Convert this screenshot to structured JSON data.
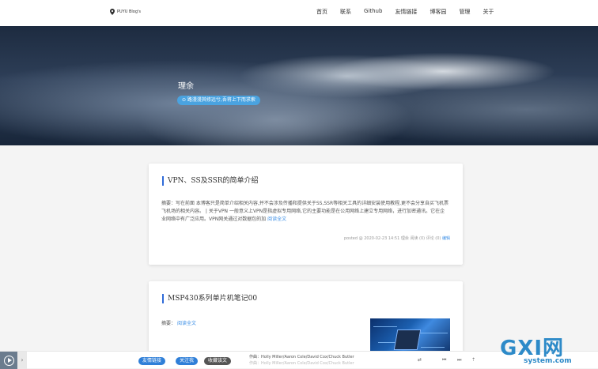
{
  "header": {
    "logo_text": "PUYU Blog's",
    "nav": [
      "首页",
      "联系",
      "Github",
      "友情链接",
      "博客园",
      "管理",
      "关于"
    ]
  },
  "hero": {
    "title": "理余",
    "motto": "⊙ 路漫漫其修远兮,吾将上下而求索"
  },
  "posts": [
    {
      "title": "VPN、SS及SSR的简单介绍",
      "summary": "摘要：写在前面 本博客只是简单介绍相关内容,并不会涉及传播和提供关于SS,SSR等相关工具的详细安装使用教程,更不会分享自买飞机票飞机场的相关内容。 | 关于VPN 一般意义上VPN是指虚拟专用网络,它的主要功能是在公用网络上建立专用网络，进行加密通讯。它在企业网络中有广泛应用。VPN网关通过对数据包的加",
      "read_more": "阅读全文",
      "meta": "posted @ 2020-02-23 14:51 理余 阅读 (0) 评论 (0)",
      "edit": "编辑"
    },
    {
      "title": "MSP430系列单片机笔记00",
      "summary_label": "摘要：",
      "read_more": "阅读全文"
    }
  ],
  "player": {
    "buttons": [
      "友情链接",
      "关注我",
      "收藏该文"
    ],
    "song_line1": "作曲：Holly Miller/Aaron Cole/David Cox/Chuck Butler",
    "song_line2": "作曲：Holly Miller/Aaron Cole/David Cox/Chuck Butler",
    "controls": [
      "⇄",
      "⏮",
      "⏭",
      "⇡"
    ]
  },
  "watermark": {
    "main": "GXI网",
    "sub": "system.com"
  },
  "colors": {
    "accent": "#2f6bd8",
    "link": "#3a8ee6",
    "motto_bg": "#4aa3e0"
  }
}
